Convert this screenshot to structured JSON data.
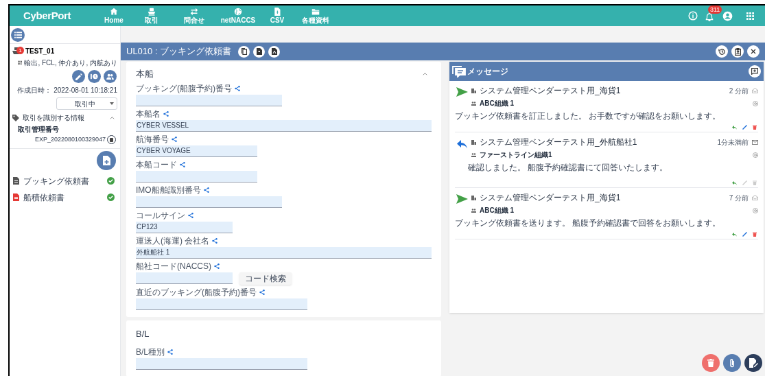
{
  "header": {
    "logo": "CyberPort",
    "nav": [
      {
        "label": "Home"
      },
      {
        "label": "取引"
      },
      {
        "label": "問合せ"
      },
      {
        "label": "netNACCS"
      },
      {
        "label": "CSV"
      },
      {
        "label": "各種資料"
      }
    ],
    "notification_count": "311"
  },
  "sidebar": {
    "deal_name": "TEST_01",
    "deal_badge": "1",
    "tags": "輸出, FCL, 仲介あり, 内航あり",
    "created": "作成日時： 2022-08-01 10:18:21",
    "status_select": "取引中",
    "section": {
      "title": "取引を識別する情報",
      "expanded": true,
      "label": "取引管理番号",
      "value": "EXP_2022080100329047"
    },
    "documents": [
      {
        "label": "ブッキング依頼書",
        "color": "#555555",
        "done": true
      },
      {
        "label": "船積依頼書",
        "color": "#e53935",
        "done": true
      }
    ]
  },
  "title_bar": {
    "title": "UL010 : ブッキング依頼書"
  },
  "sections": [
    {
      "title": "本船",
      "expanded": true,
      "fields": [
        {
          "label": "ブッキング(船腹予約)番号"
        },
        {
          "label": "本船名",
          "value": "CYBER VESSEL"
        },
        {
          "label": "航海番号",
          "value": "CYBER VOYAGE"
        },
        {
          "label": "本船コード"
        },
        {
          "label": "IMO船舶識別番号"
        },
        {
          "label": "コールサイン",
          "value": "CP123"
        },
        {
          "label": "運送人(海運) 会社名",
          "value": "外航船社 1"
        },
        {
          "label": "船社コード(NACCS)",
          "button": "コード検索"
        },
        {
          "label": "直近のブッキング(船腹予約)番号"
        }
      ]
    },
    {
      "title": "B/L",
      "fields": [
        {
          "label": "B/L種別"
        }
      ]
    }
  ],
  "messages": {
    "title": "メッセージ",
    "items": [
      {
        "kind": "sent",
        "sender": "システム管理ベンダーテスト用_海貨1",
        "org": "ABC組織 1",
        "time": "2 分前",
        "read": true,
        "body": "ブッキング依頼書を訂正しました。 お手数ですが確認をお願いします。",
        "editable": true
      },
      {
        "kind": "reply",
        "sender": "システム管理ベンダーテスト用_外航船社1",
        "org": "ファーストライン組織1",
        "time": "1分未満前",
        "read": false,
        "body": "確認しました。 船腹予約確認書にて回答いたします。",
        "editable": false
      },
      {
        "kind": "sent",
        "sender": "システム管理ベンダーテスト用_海貨1",
        "org": "ABC組織 1",
        "time": "7 分前",
        "read": true,
        "body": "ブッキング依頼書を送ります。 船腹予約確認書で回答をお願いします。",
        "editable": true
      }
    ]
  }
}
